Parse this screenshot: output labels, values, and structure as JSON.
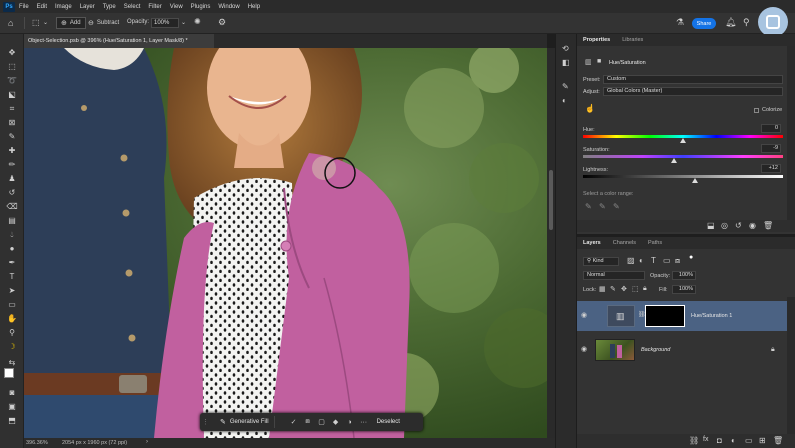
{
  "menu": {
    "logo": "Ps",
    "items": [
      "File",
      "Edit",
      "Image",
      "Layer",
      "Type",
      "Select",
      "Filter",
      "View",
      "Plugins",
      "Window",
      "Help"
    ]
  },
  "options_bar": {
    "add_label": "Add",
    "subtract_label": "Subtract",
    "opacity_label": "Opacity:",
    "opacity_value": "100%",
    "share_label": "Share"
  },
  "document": {
    "tab_title": "Object-Selection.psb @ 396% (Hue/Saturation 1, Layer Mask/8) *"
  },
  "status": {
    "zoom": "396.36%",
    "dims": "2054 px x 1960 px (72 ppi)"
  },
  "contextual_bar": {
    "generative_fill": "Generative Fill",
    "deselect": "Deselect"
  },
  "properties": {
    "tabs": [
      "Properties",
      "Libraries"
    ],
    "title": "Hue/Saturation",
    "preset_label": "Preset:",
    "preset_value": "Custom",
    "adjust_label": "Adjust:",
    "adjust_value": "Global Colors (Master)",
    "colorize_label": "Colorize",
    "hue_label": "Hue:",
    "hue_value": "0",
    "hue_level": 0.5,
    "saturation_label": "Saturation:",
    "saturation_value": "-9",
    "saturation_level": 0.455,
    "lightness_label": "Lightness:",
    "lightness_value": "+12",
    "lightness_level": 0.56,
    "select_color_range": "Select a color range:"
  },
  "layers": {
    "tabs": [
      "Layers",
      "Channels",
      "Paths"
    ],
    "kind_label": "Kind",
    "blend_mode": "Normal",
    "opacity_label": "Opacity:",
    "opacity_value": "100%",
    "lock_label": "Lock:",
    "fill_label": "Fill:",
    "fill_value": "100%",
    "items": [
      {
        "name": "Hue/Saturation 1",
        "selected": true
      },
      {
        "name": "Background",
        "selected": false
      }
    ]
  },
  "colors": {
    "accent": "#1473e6",
    "selected_layer": "#4b6283",
    "jacket": "#c1609f"
  }
}
